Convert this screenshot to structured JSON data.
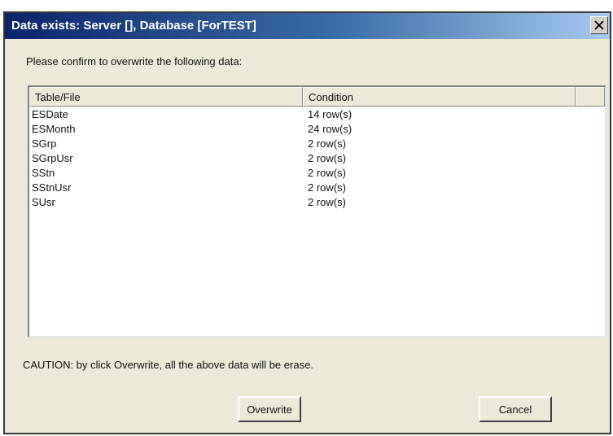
{
  "window": {
    "title": "Data exists: Server [], Database [ForTEST]",
    "close_icon": "close-icon"
  },
  "prompt": "Please confirm to overwrite the following data:",
  "table": {
    "columns": [
      "Table/File",
      "Condition",
      ""
    ],
    "rows": [
      {
        "name": "ESDate",
        "condition": "14 row(s)"
      },
      {
        "name": "ESMonth",
        "condition": "24 row(s)"
      },
      {
        "name": "SGrp",
        "condition": "2 row(s)"
      },
      {
        "name": "SGrpUsr",
        "condition": "2 row(s)"
      },
      {
        "name": "SStn",
        "condition": "2 row(s)"
      },
      {
        "name": "SStnUsr",
        "condition": "2 row(s)"
      },
      {
        "name": "SUsr",
        "condition": "2 row(s)"
      }
    ]
  },
  "caution": "CAUTION: by click Overwrite, all the above data will be erase.",
  "buttons": {
    "overwrite": "Overwrite",
    "cancel": "Cancel"
  },
  "colors": {
    "title_gradient_start": "#0a246a",
    "title_gradient_end": "#a6caf0",
    "dialog_background": "#ece9d8"
  }
}
